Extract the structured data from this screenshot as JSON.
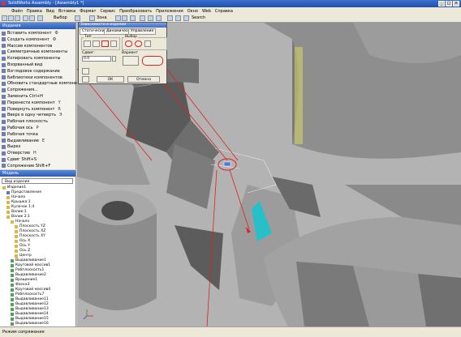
{
  "window": {
    "title": "SolidWorks Assembly - [Assembly1 *]"
  },
  "menu": [
    "Файл",
    "Правка",
    "Вид",
    "Вставка",
    "Формат",
    "Сервис",
    "Преобразовать",
    "Приложения",
    "Окно",
    "Web",
    "Справка",
    "Search"
  ],
  "toolbar": {
    "select_label": "Выбор",
    "zoom_label": "Зона",
    "search_label": "Search"
  },
  "feature_panel": {
    "header": "Издания",
    "items": [
      {
        "label": "Вставить компонент",
        "key": "Ф"
      },
      {
        "label": "Создать компонент",
        "key": "Ф"
      },
      {
        "label": "Массив компонентов",
        "key": ""
      },
      {
        "label": "Симметричные компоненты",
        "key": ""
      },
      {
        "label": "Копировать компоненты",
        "key": ""
      },
      {
        "label": "Взорванный вид",
        "key": ""
      },
      {
        "label": "Взглядовое содержание",
        "key": ""
      },
      {
        "label": "Библиотеки компонентов",
        "key": ""
      },
      {
        "label": "Обновить стандартные компоненты",
        "key": ""
      },
      {
        "label": "Сопряжения...",
        "key": ""
      },
      {
        "label": "Заменить   Ctrl+H",
        "key": ""
      },
      {
        "label": "Перенести компонент",
        "key": "Y"
      },
      {
        "label": "Повернуть компонент",
        "key": "R"
      },
      {
        "label": "Вверх в одну четверть",
        "key": "Э"
      },
      {
        "label": "Рабочая плоскость",
        "key": ""
      },
      {
        "label": "Рабочая ось",
        "key": "Р"
      },
      {
        "label": "Рабочая точка",
        "key": ""
      },
      {
        "label": "Выдавливание",
        "key": "E"
      },
      {
        "label": "Вырез",
        "key": ""
      },
      {
        "label": "Отверстие",
        "key": "Н"
      },
      {
        "label": "Сдвиг   Shift+S",
        "key": ""
      },
      {
        "label": "Сопряжение   Shift+F",
        "key": ""
      }
    ]
  },
  "tree_panel": {
    "header": "Модель",
    "view_label": "Вид изделия",
    "items": [
      {
        "label": "Изделие1",
        "indent": 0,
        "c": "y"
      },
      {
        "label": "Представления",
        "indent": 1,
        "c": "b"
      },
      {
        "label": "Начало",
        "indent": 1,
        "c": "y"
      },
      {
        "label": "Крышка:1",
        "indent": 1,
        "c": "y"
      },
      {
        "label": "Кулачок 1:4",
        "indent": 1,
        "c": "y"
      },
      {
        "label": "Валик:1",
        "indent": 1,
        "c": "y"
      },
      {
        "label": "Валик 2:1",
        "indent": 1,
        "c": "y"
      },
      {
        "label": "Начало",
        "indent": 2,
        "c": "y"
      },
      {
        "label": "Плоскость YZ",
        "indent": 3,
        "c": "y"
      },
      {
        "label": "Плоскость XZ",
        "indent": 3,
        "c": "y"
      },
      {
        "label": "Плоскость XY",
        "indent": 3,
        "c": "y"
      },
      {
        "label": "Ось X",
        "indent": 3,
        "c": "y"
      },
      {
        "label": "Ось Y",
        "indent": 3,
        "c": "y"
      },
      {
        "label": "Ось Z",
        "indent": 3,
        "c": "y"
      },
      {
        "label": "Центр",
        "indent": 3,
        "c": "y"
      },
      {
        "label": "Выдавливание1",
        "indent": 2,
        "c": "g"
      },
      {
        "label": "Круговой массив1",
        "indent": 2,
        "c": "g"
      },
      {
        "label": "Рабплоскость1",
        "indent": 2,
        "c": "g"
      },
      {
        "label": "Выдавливание2",
        "indent": 2,
        "c": "g"
      },
      {
        "label": "Вращение1",
        "indent": 2,
        "c": "g"
      },
      {
        "label": "Фаска3",
        "indent": 2,
        "c": "g"
      },
      {
        "label": "Круговой массив4",
        "indent": 2,
        "c": "g"
      },
      {
        "label": "Рабплоскость7",
        "indent": 2,
        "c": "g"
      },
      {
        "label": "Выдавливание11",
        "indent": 2,
        "c": "g"
      },
      {
        "label": "Выдавливание12",
        "indent": 2,
        "c": "g"
      },
      {
        "label": "Выдавливание13",
        "indent": 2,
        "c": "g"
      },
      {
        "label": "Выдавливание14",
        "indent": 2,
        "c": "g"
      },
      {
        "label": "Выдавливание15",
        "indent": 2,
        "c": "g"
      },
      {
        "label": "Выдавливание16",
        "indent": 2,
        "c": "g"
      }
    ]
  },
  "dialog": {
    "title": "Зависимости в изделии",
    "tabs": [
      "Статические",
      "Динамические",
      "Управление"
    ],
    "group_type": "Тип",
    "group_selection": "Выбор",
    "offset_label": "Сдвиг:",
    "offset_value": "0.0",
    "variant_label": "Вариант",
    "ok": "ОК",
    "cancel": "Отмена"
  },
  "status": {
    "text": "Режим сопряжения"
  },
  "colors": {
    "highlight_red": "#e02020",
    "face_cyan": "#28c0c8",
    "axis_yellow": "#d8d860"
  }
}
